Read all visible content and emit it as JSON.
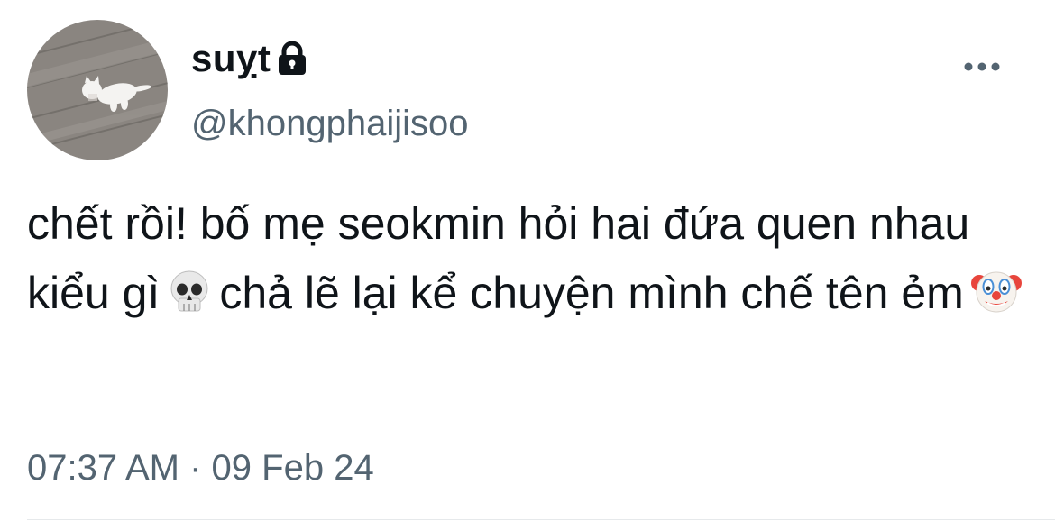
{
  "author": {
    "display_name": "suỵt",
    "handle": "@khongphaijisoo",
    "avatar_icon": "avatar-white-cat-on-wood-floor",
    "protected_icon": "lock-icon"
  },
  "tweet": {
    "text_part1": "chết rồi! bố mẹ seokmin hỏi hai đứa quen nhau kiểu gì",
    "emoji1": "skull-emoji",
    "text_part2": "chả lẽ lại kể chuyện mình chế tên ẻm",
    "emoji2": "clown-face-emoji"
  },
  "meta": {
    "timestamp": "07:37 AM · 09 Feb 24"
  },
  "actions": {
    "more_icon": "more-horizontal-icon"
  },
  "colors": {
    "text": "#0f1419",
    "secondary": "#536471",
    "divider": "#e6e9eb"
  }
}
